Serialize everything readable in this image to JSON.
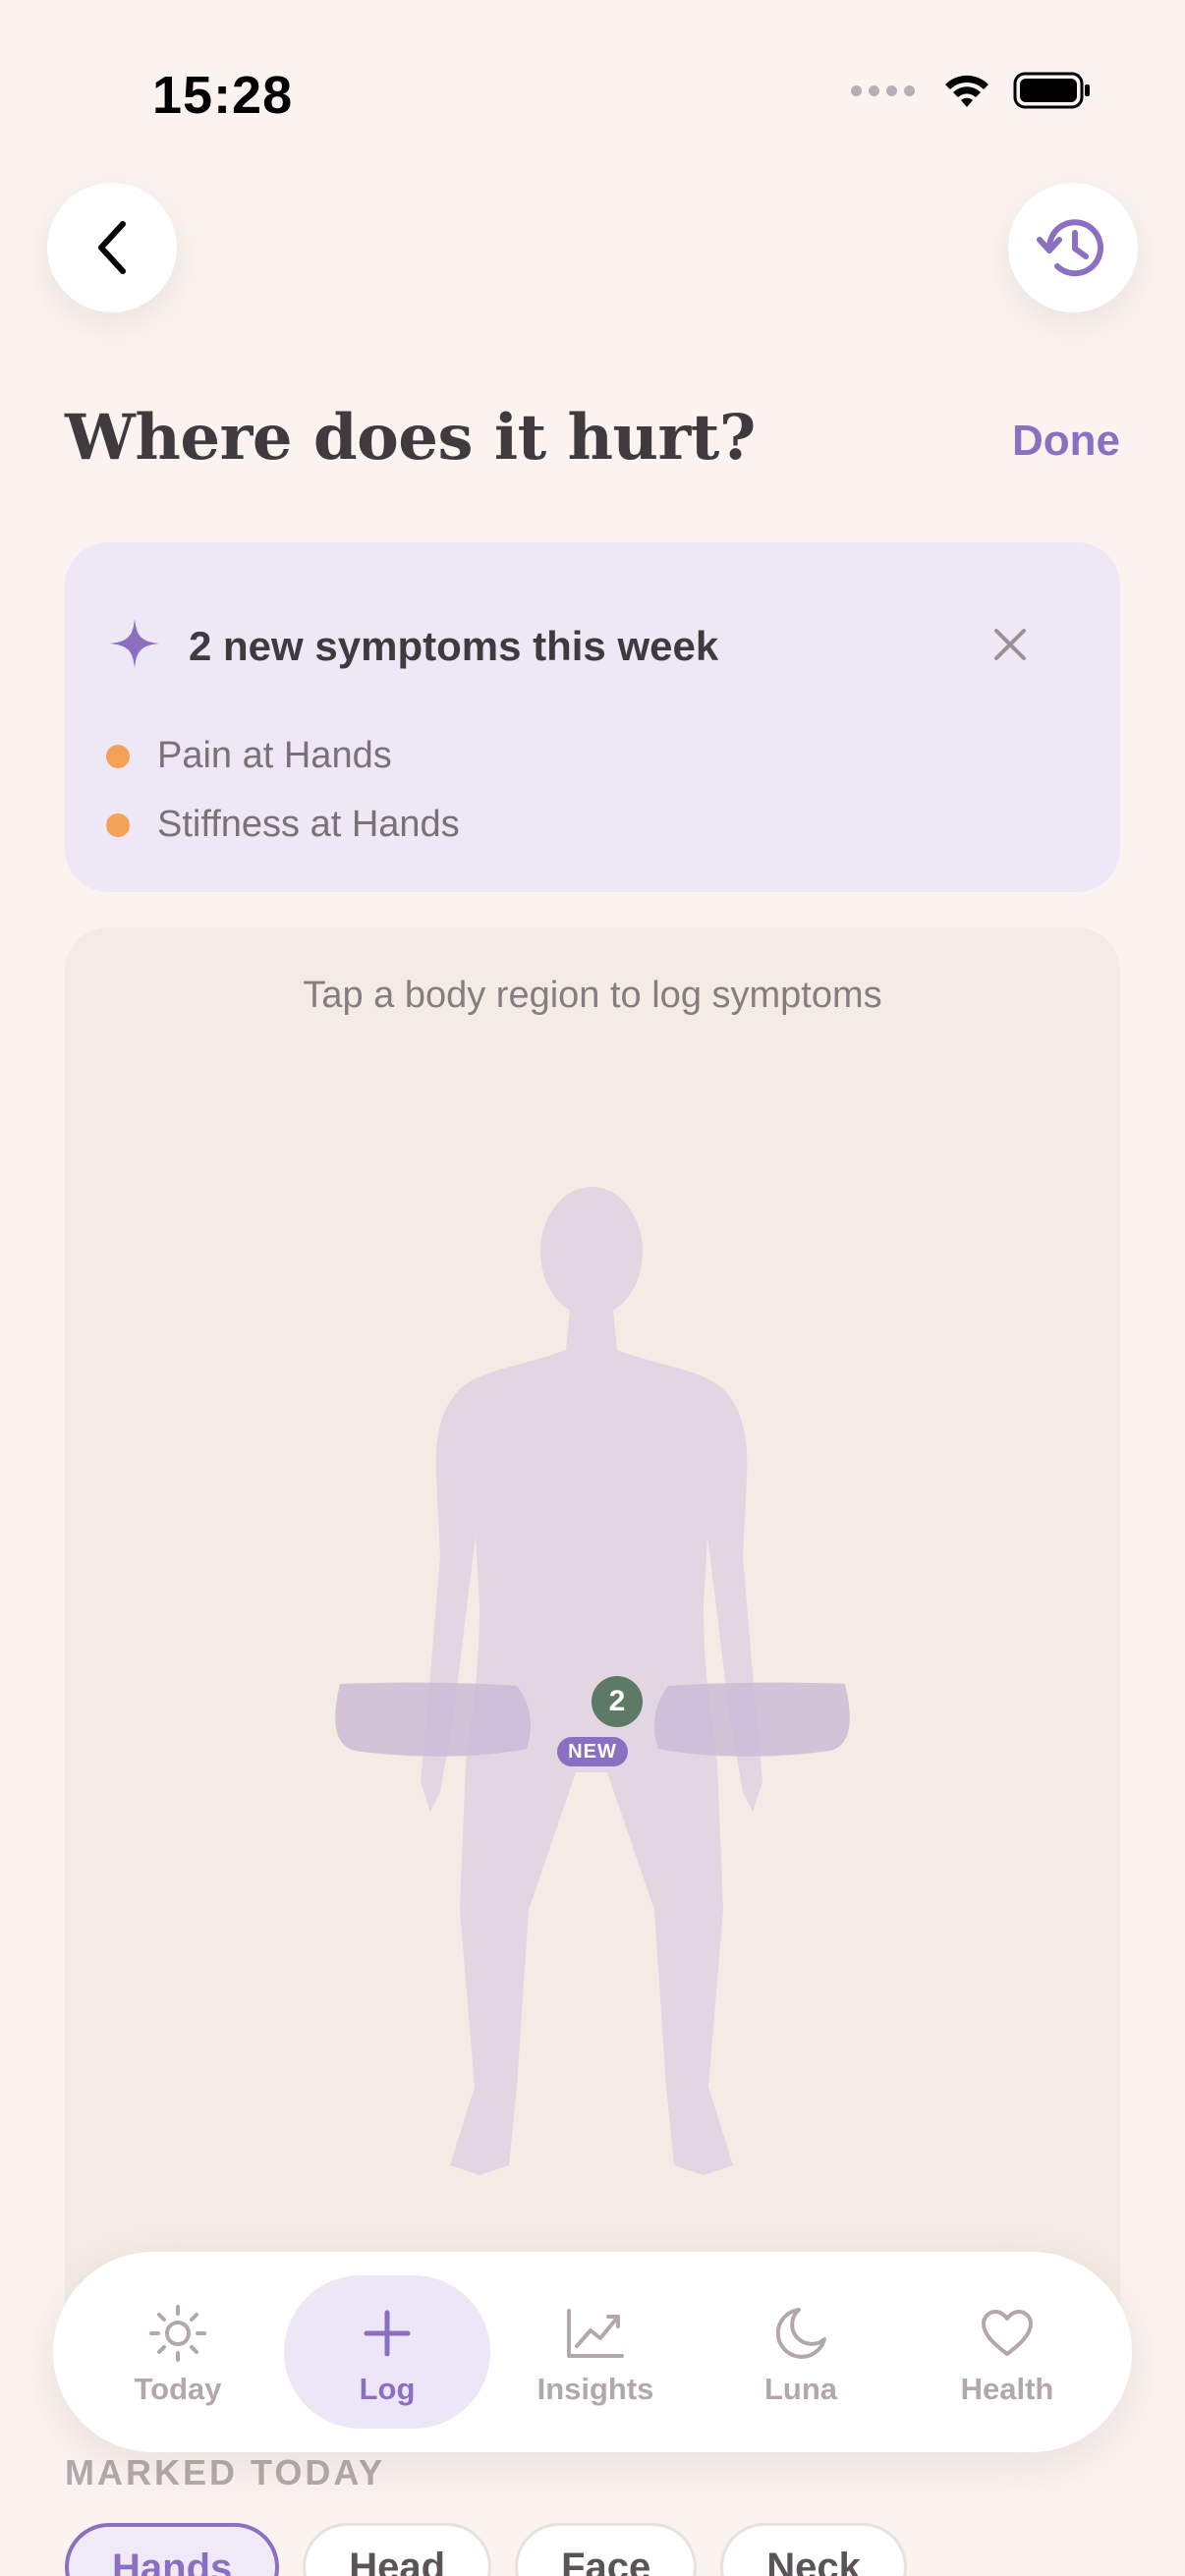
{
  "status_bar": {
    "time": "15:28"
  },
  "header": {
    "title": "Where does it hurt?",
    "done_label": "Done"
  },
  "symptoms_card": {
    "title": "2 new symptoms this week",
    "items": [
      "Pain at Hands",
      "Stiffness at Hands"
    ]
  },
  "body_map": {
    "hint": "Tap a body region to log symptoms",
    "hands_count": "2",
    "new_badge": "NEW"
  },
  "marked_today": {
    "label": "MARKED TODAY",
    "chips": [
      "Hands",
      "Head",
      "Face",
      "Neck"
    ],
    "selected": "Hands"
  },
  "tab_bar": {
    "items": [
      {
        "label": "Today",
        "icon": "sun-icon"
      },
      {
        "label": "Log",
        "icon": "plus-icon"
      },
      {
        "label": "Insights",
        "icon": "chart-icon"
      },
      {
        "label": "Luna",
        "icon": "moon-icon"
      },
      {
        "label": "Health",
        "icon": "heart-icon"
      }
    ],
    "active": "Log"
  },
  "colors": {
    "accent": "#8B6FC0",
    "background": "#FAF3EF",
    "card": "#EEE8F6",
    "body_map": "#F3ECE4",
    "symptom_dot": "#F2A157",
    "count_badge": "#5D7A66"
  }
}
